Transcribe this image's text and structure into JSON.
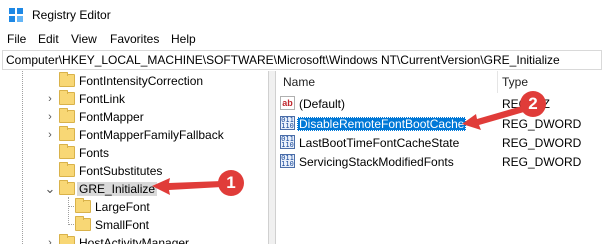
{
  "window": {
    "title": "Registry Editor",
    "icon": "registry-editor-icon"
  },
  "menu": [
    "File",
    "Edit",
    "View",
    "Favorites",
    "Help"
  ],
  "address": "Computer\\HKEY_LOCAL_MACHINE\\SOFTWARE\\Microsoft\\Windows NT\\CurrentVersion\\GRE_Initialize",
  "tree": {
    "items": [
      {
        "label": "FontIntensityCorrection",
        "expander": "",
        "selected": false
      },
      {
        "label": "FontLink",
        "expander": "›",
        "selected": false
      },
      {
        "label": "FontMapper",
        "expander": "›",
        "selected": false
      },
      {
        "label": "FontMapperFamilyFallback",
        "expander": "›",
        "selected": false
      },
      {
        "label": "Fonts",
        "expander": "",
        "selected": false
      },
      {
        "label": "FontSubstitutes",
        "expander": "",
        "selected": false
      },
      {
        "label": "GRE_Initialize",
        "expander": "⌄",
        "selected": true
      },
      {
        "label": "LargeFont",
        "expander": "",
        "selected": false,
        "child": true
      },
      {
        "label": "SmallFont",
        "expander": "",
        "selected": false,
        "child": true
      },
      {
        "label": "HostActivityManager",
        "expander": "›",
        "selected": false
      }
    ]
  },
  "values_pane": {
    "columns": {
      "name": "Name",
      "type": "Type"
    },
    "rows": [
      {
        "icon": "string-value-icon",
        "icon_text": "ab",
        "name": "(Default)",
        "type": "REG_SZ",
        "selected": false
      },
      {
        "icon": "binary-value-icon",
        "icon_text": "011\n110",
        "name": "DisableRemoteFontBootCache",
        "type": "REG_DWORD",
        "selected": true
      },
      {
        "icon": "binary-value-icon",
        "icon_text": "011\n110",
        "name": "LastBootTimeFontCacheState",
        "type": "REG_DWORD",
        "selected": false
      },
      {
        "icon": "binary-value-icon",
        "icon_text": "011\n110",
        "name": "ServicingStackModifiedFonts",
        "type": "REG_DWORD",
        "selected": false
      }
    ]
  },
  "callouts": [
    {
      "number": "1",
      "color": "#e03c39"
    },
    {
      "number": "2",
      "color": "#e03c39"
    }
  ],
  "colors": {
    "selection": "#0078d7",
    "tree_selection": "#d9d9d9",
    "folder": "#f8d775",
    "callout": "#e03c39"
  }
}
